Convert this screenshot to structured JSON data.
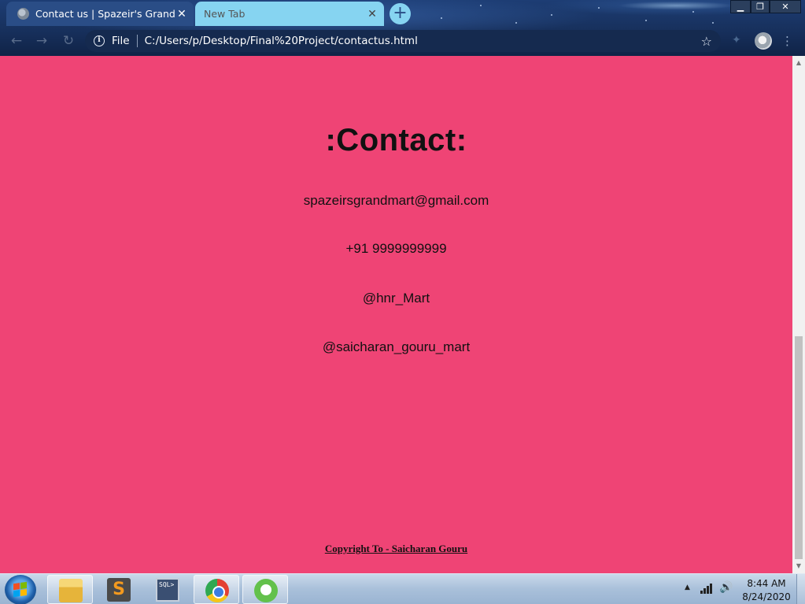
{
  "browser": {
    "tabs": [
      {
        "title": "Contact us | Spazeir's Grand Mart",
        "active": true
      },
      {
        "title": "New Tab",
        "active": false
      }
    ],
    "new_tab_label": "+",
    "address": {
      "scheme_label": "File",
      "url": "C:/Users/p/Desktop/Final%20Project/contactus.html"
    }
  },
  "page": {
    "heading": ":Contact:",
    "email": "spazeirsgrandmart@gmail.com",
    "phone": "+91 9999999999",
    "handle_1": "@hnr_Mart",
    "handle_2": "@saicharan_gouru_mart",
    "footer": "Copyright To - Saicharan Gouru",
    "background_color": "#ef4475"
  },
  "taskbar": {
    "pinned_apps": [
      "folder-icon",
      "sublime-text-icon",
      "sql-console-icon",
      "chrome-icon",
      "green-app-icon"
    ],
    "clock_time": "8:44 AM",
    "clock_date": "8/24/2020"
  }
}
